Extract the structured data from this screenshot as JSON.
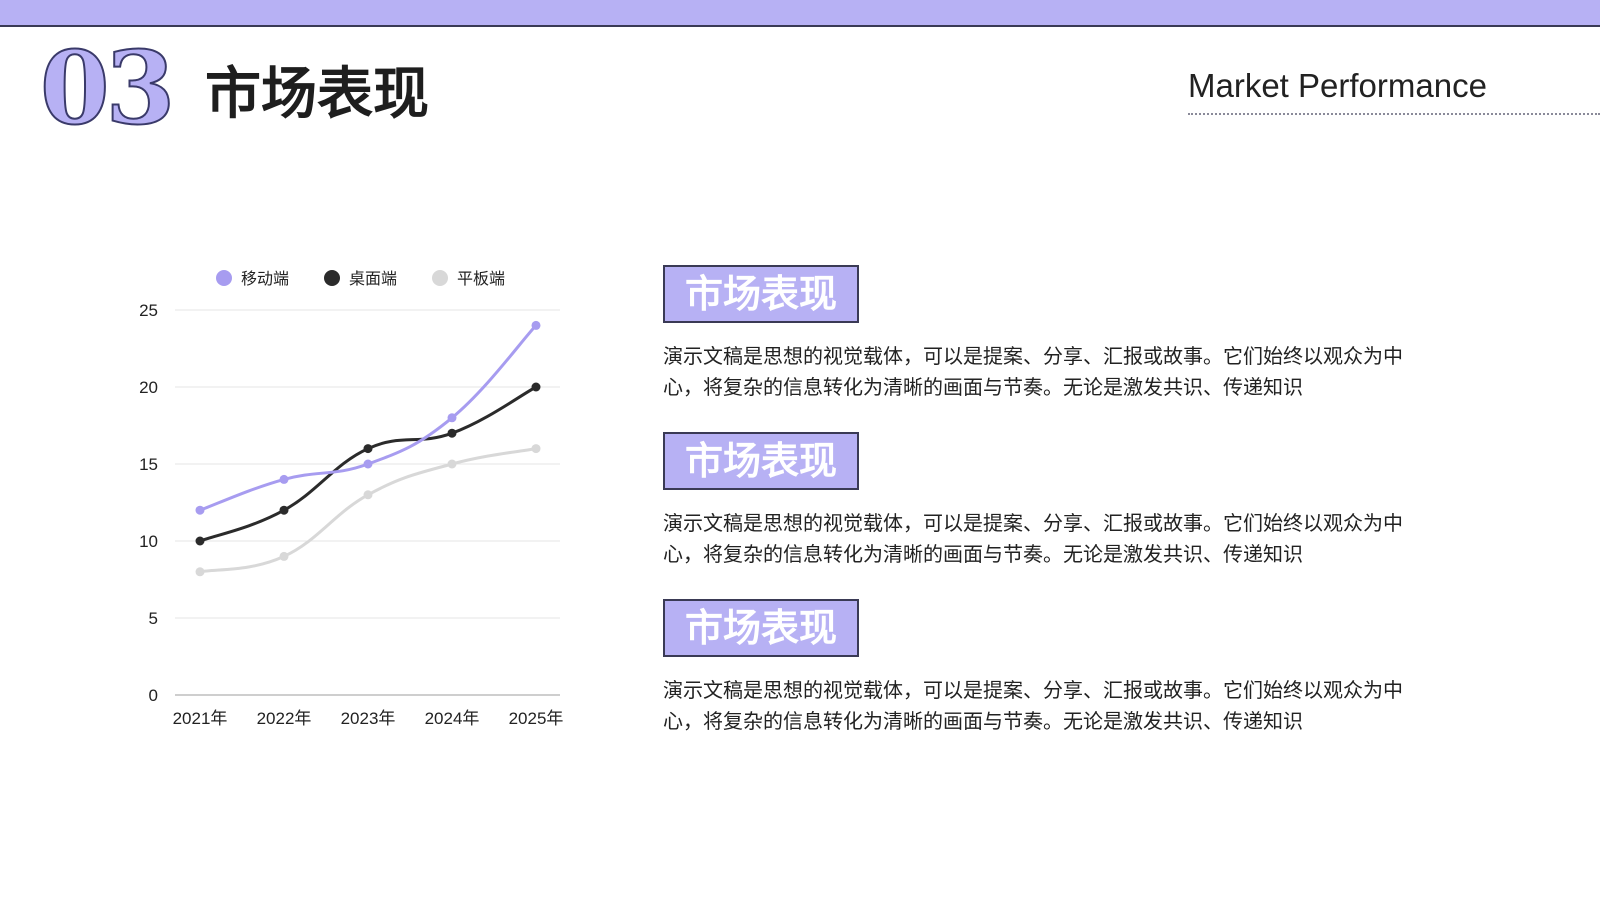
{
  "header": {
    "number": "03",
    "title": "市场表现",
    "subtitle": "Market Performance"
  },
  "colors": {
    "accent": "#b7b1f4",
    "dark": "#2b2b2b",
    "light": "#d8d8d8"
  },
  "chart_data": {
    "type": "line",
    "categories": [
      "2021年",
      "2022年",
      "2023年",
      "2024年",
      "2025年"
    ],
    "series": [
      {
        "name": "移动端",
        "color": "#a79cf0",
        "values": [
          12,
          14,
          15,
          18,
          24
        ]
      },
      {
        "name": "桌面端",
        "color": "#2b2b2b",
        "values": [
          10,
          12,
          16,
          17,
          20
        ]
      },
      {
        "name": "平板端",
        "color": "#d8d8d8",
        "values": [
          8,
          9,
          13,
          15,
          16
        ]
      }
    ],
    "yticks": [
      0,
      5,
      10,
      15,
      20,
      25
    ],
    "ylim": [
      0,
      25
    ],
    "grid": true,
    "legend": "top-center"
  },
  "blocks": [
    {
      "title": "市场表现",
      "text": "演示文稿是思想的视觉载体，可以是提案、分享、汇报或故事。它们始终以观众为中心，将复杂的信息转化为清晰的画面与节奏。无论是激发共识、传递知识"
    },
    {
      "title": "市场表现",
      "text": "演示文稿是思想的视觉载体，可以是提案、分享、汇报或故事。它们始终以观众为中心，将复杂的信息转化为清晰的画面与节奏。无论是激发共识、传递知识"
    },
    {
      "title": "市场表现",
      "text": "演示文稿是思想的视觉载体，可以是提案、分享、汇报或故事。它们始终以观众为中心，将复杂的信息转化为清晰的画面与节奏。无论是激发共识、传递知识"
    }
  ]
}
